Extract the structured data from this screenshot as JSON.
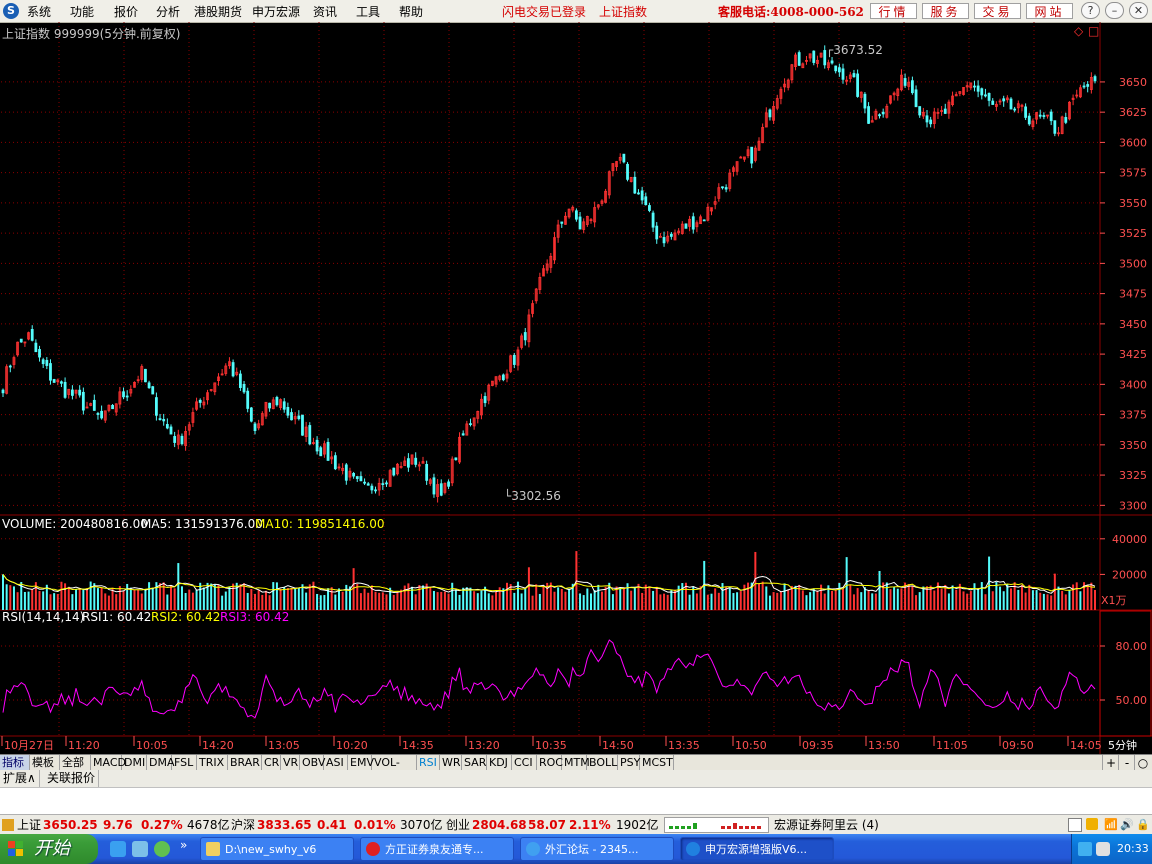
{
  "app": {
    "logo": "S",
    "menu": [
      "系统",
      "功能",
      "报价",
      "分析",
      "港股期货",
      "申万宏源",
      "资讯",
      "工具",
      "帮助"
    ],
    "flash_status": "闪电交易已登录",
    "index_name": "上证指数",
    "hotline": "客服电话:4008-000-562",
    "red_buttons": [
      "行情",
      "服务",
      "交易",
      "网站"
    ],
    "window_controls": [
      "?",
      "–",
      "▫",
      "✕"
    ]
  },
  "chart_header": {
    "title": "上证指数 999999(5分钟.前复权)",
    "icons": [
      "◇",
      "□"
    ]
  },
  "price_annotations": {
    "high": "3673.52",
    "low": "3302.56"
  },
  "volume_panel": {
    "label": "VOLUME: 200480816.00",
    "ma5": "MA5: 131591376.00",
    "ma10": "MA10: 119851416.00",
    "axis_unit": "X1万",
    "ticks": [
      "40000",
      "20000"
    ]
  },
  "rsi_panel": {
    "label": "RSI(14,14,14)",
    "rsi1": "RSI1: 60.42",
    "rsi2": "RSI2: 60.42",
    "rsi3": "RSI3: 60.42",
    "ticks": [
      "80.00",
      "50.00"
    ]
  },
  "time_axis": {
    "labels": [
      "10月27日",
      "11:20",
      "10:05",
      "14:20",
      "13:05",
      "10:20",
      "14:35",
      "13:20",
      "10:35",
      "14:50",
      "13:35",
      "10:50",
      "09:35",
      "13:50",
      "11:05",
      "09:50",
      "14:05"
    ],
    "period": "5分钟"
  },
  "indicator_tabs": [
    "指标",
    "模板",
    "全部",
    "MACD",
    "DMI",
    "DMA",
    "FSL",
    "TRIX",
    "BRAR",
    "CR",
    "VR",
    "OBV",
    "ASI",
    "EMV",
    "VOL-TDX",
    "RSI",
    "WR",
    "SAR",
    "KDJ",
    "CCI",
    "ROC",
    "MTM",
    "BOLL",
    "PSY",
    "MCST"
  ],
  "tab_controls": [
    "+",
    "-",
    "○"
  ],
  "ext_tabs": [
    "扩展∧",
    "关联报价"
  ],
  "status_bar": {
    "sh_label": "上证",
    "sh_value": "3650.25",
    "sh_change": "9.76",
    "sh_pct": "0.27%",
    "sh_amount": "4678亿",
    "hs_label": "沪深",
    "hs_value": "3833.65",
    "hs_change": "0.41",
    "hs_pct": "0.01%",
    "hs_amount": "3070亿",
    "cy_label": "创业",
    "cy_value": "2804.68",
    "cy_change": "58.07",
    "cy_pct": "2.11%",
    "cy_amount": "1902亿",
    "server": "宏源证券阿里云 (4)"
  },
  "taskbar": {
    "start": "开始",
    "tasks": [
      "D:\\new_swhy_v6",
      "方正证券泉友通专...",
      "外汇论坛 - 2345...",
      "申万宏源增强版V6..."
    ],
    "clock": "20:33"
  },
  "colors": {
    "up": "#ff3232",
    "down": "#54fcfc",
    "grid": "#8c0000",
    "axis_text": "#ff5050",
    "ma5": "#ffffff",
    "ma10": "#ffff00",
    "rsi": "#ff00ff"
  },
  "chart_data": {
    "type": "candlestick",
    "price_axis": {
      "ticks": [
        3300,
        3325,
        3350,
        3375,
        3400,
        3425,
        3450,
        3475,
        3500,
        3525,
        3550,
        3575,
        3600,
        3625,
        3650
      ],
      "range": [
        3292,
        3683
      ]
    },
    "series_close_approx": [
      [
        3400,
        3430,
        3440,
        3418,
        3404,
        3395,
        3388,
        3378,
        3370,
        3386,
        3396,
        3410,
        3385,
        3365,
        3352,
        3372,
        3390,
        3405,
        3418,
        3396,
        3360,
        3380,
        3388,
        3372,
        3362,
        3350,
        3340,
        3330,
        3318,
        3312,
        3322,
        3328,
        3334,
        3338,
        3322,
        3305,
        3340,
        3366,
        3385,
        3400,
        3412,
        3425,
        3455,
        3490,
        3520,
        3548,
        3530,
        3540,
        3562,
        3585,
        3570,
        3550,
        3525,
        3520,
        3528,
        3535,
        3540,
        3560,
        3572,
        3585,
        3592,
        3625,
        3650,
        3665,
        3672,
        3668,
        3662,
        3658,
        3645,
        3620,
        3628,
        3640,
        3655,
        3630,
        3618,
        3624,
        3636,
        3652,
        3638,
        3628,
        3630,
        3625,
        3620,
        3618,
        3610,
        3628,
        3645,
        3650
      ]
    ],
    "volume_range": [
      0,
      50000
    ],
    "rsi_range": [
      30,
      100
    ]
  }
}
